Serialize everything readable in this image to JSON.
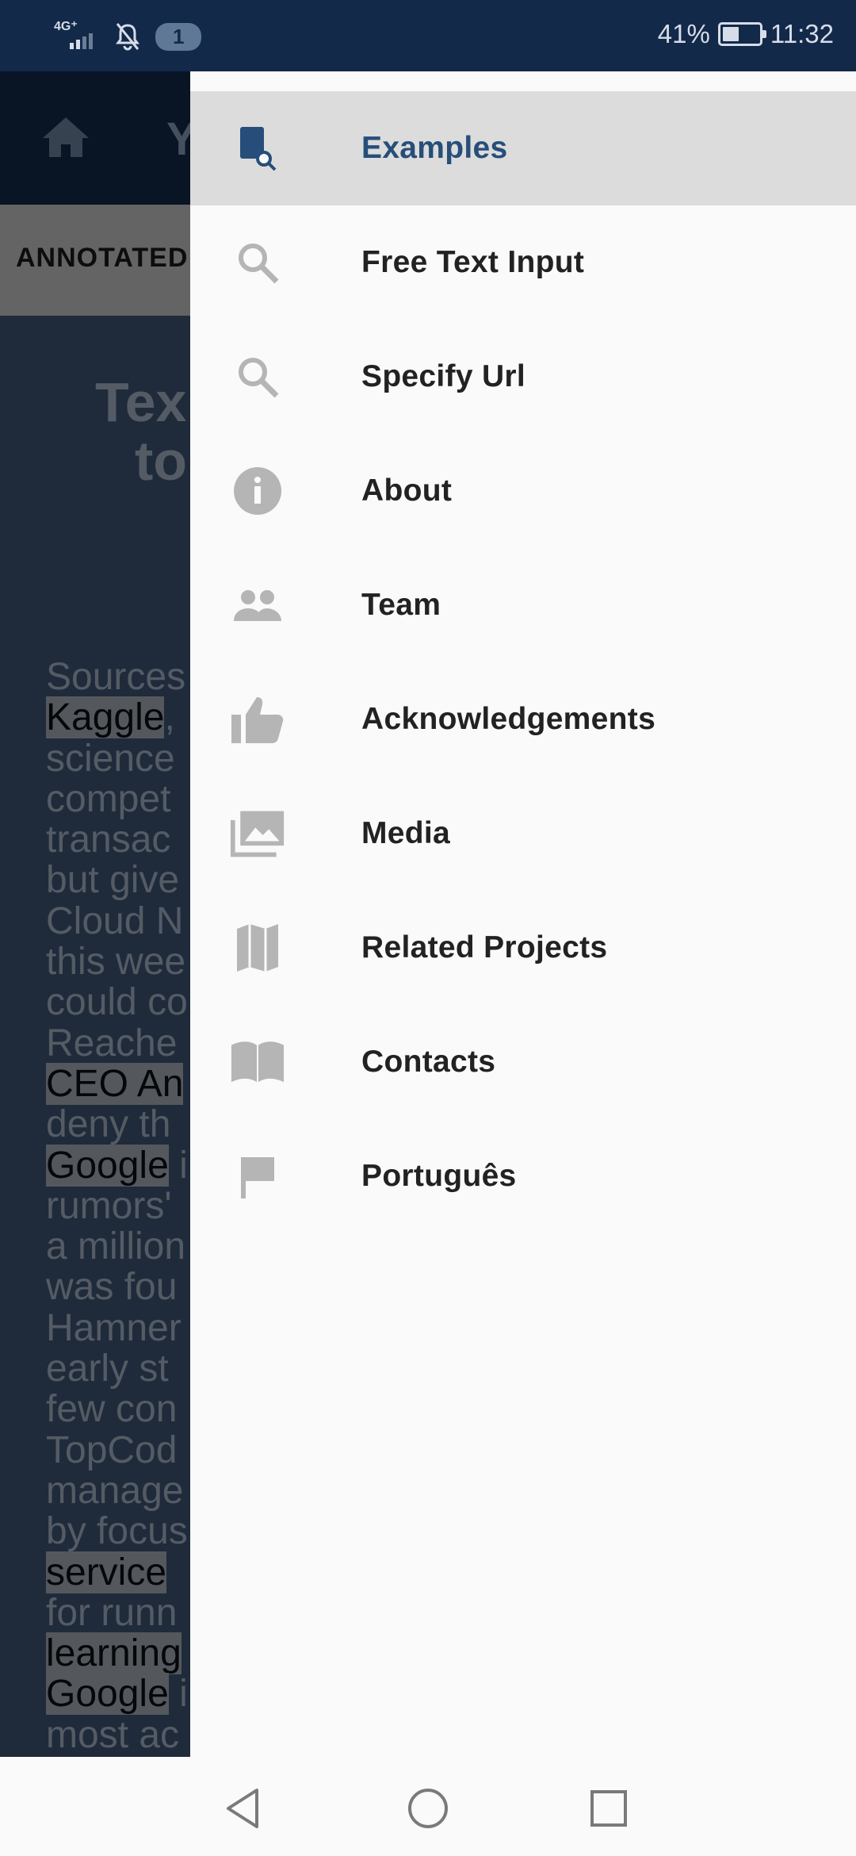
{
  "status_bar": {
    "network": "4G⁺",
    "notification_count": "1",
    "battery_percent": "41%",
    "battery_level": 0.41,
    "time": "11:32"
  },
  "background_app": {
    "title_fragment": "Y",
    "tab_label": "ANNOTATED",
    "heading_fragment": [
      "Tex",
      "to"
    ],
    "body_lines": [
      {
        "text": "Sources",
        "highlight": false
      },
      {
        "text": "Kaggle",
        "highlight": true,
        "suffix": ","
      },
      {
        "text": "science",
        "highlight": false
      },
      {
        "text": "compet",
        "highlight": false
      },
      {
        "text": "transac",
        "highlight": false
      },
      {
        "text": "but give",
        "highlight": false
      },
      {
        "text": "Cloud N",
        "highlight": false
      },
      {
        "text": "this wee",
        "highlight": false
      },
      {
        "text": "could co",
        "highlight": false
      },
      {
        "text": "Reache",
        "highlight": false
      },
      {
        "text": "CEO An",
        "highlight": true,
        "suffix": ""
      },
      {
        "text": "deny th",
        "highlight": false
      },
      {
        "text": "Google",
        "highlight": true,
        "suffix": " i"
      },
      {
        "text": "rumors'",
        "highlight": false
      },
      {
        "text": "a million",
        "highlight": false
      },
      {
        "text": "was fou",
        "highlight": false
      },
      {
        "text": "Hamner",
        "highlight": false
      },
      {
        "text": "early st",
        "highlight": false
      },
      {
        "text": "few con",
        "highlight": false
      },
      {
        "text": "TopCod",
        "highlight": false
      },
      {
        "text": "manage",
        "highlight": false
      },
      {
        "text": "by focus",
        "highlight": false
      },
      {
        "text": "service",
        "highlight": true,
        "suffix": ""
      },
      {
        "text": "for runn",
        "highlight": false
      },
      {
        "text": "learning",
        "highlight": true,
        "suffix": ""
      },
      {
        "text": "Google",
        "highlight": true,
        "suffix": " i"
      },
      {
        "text": "most ac",
        "highlight": false
      }
    ]
  },
  "drawer": {
    "items": [
      {
        "label": "Examples",
        "icon": "examples-icon",
        "active": true
      },
      {
        "label": "Free Text Input",
        "icon": "search-icon",
        "active": false
      },
      {
        "label": "Specify Url",
        "icon": "search-icon",
        "active": false
      },
      {
        "label": "About",
        "icon": "info-icon",
        "active": false
      },
      {
        "label": "Team",
        "icon": "people-icon",
        "active": false
      },
      {
        "label": "Acknowledgements",
        "icon": "thumbs-up-icon",
        "active": false
      },
      {
        "label": "Media",
        "icon": "photo-library-icon",
        "active": false
      },
      {
        "label": "Related Projects",
        "icon": "map-icon",
        "active": false
      },
      {
        "label": "Contacts",
        "icon": "book-icon",
        "active": false
      },
      {
        "label": "Português",
        "icon": "flag-icon",
        "active": false
      }
    ]
  },
  "colors": {
    "status_bar": "#13294a",
    "active_item_bg": "#dcdcdc",
    "active_label": "#274e7a",
    "icon_gray": "#b5b5b5"
  }
}
